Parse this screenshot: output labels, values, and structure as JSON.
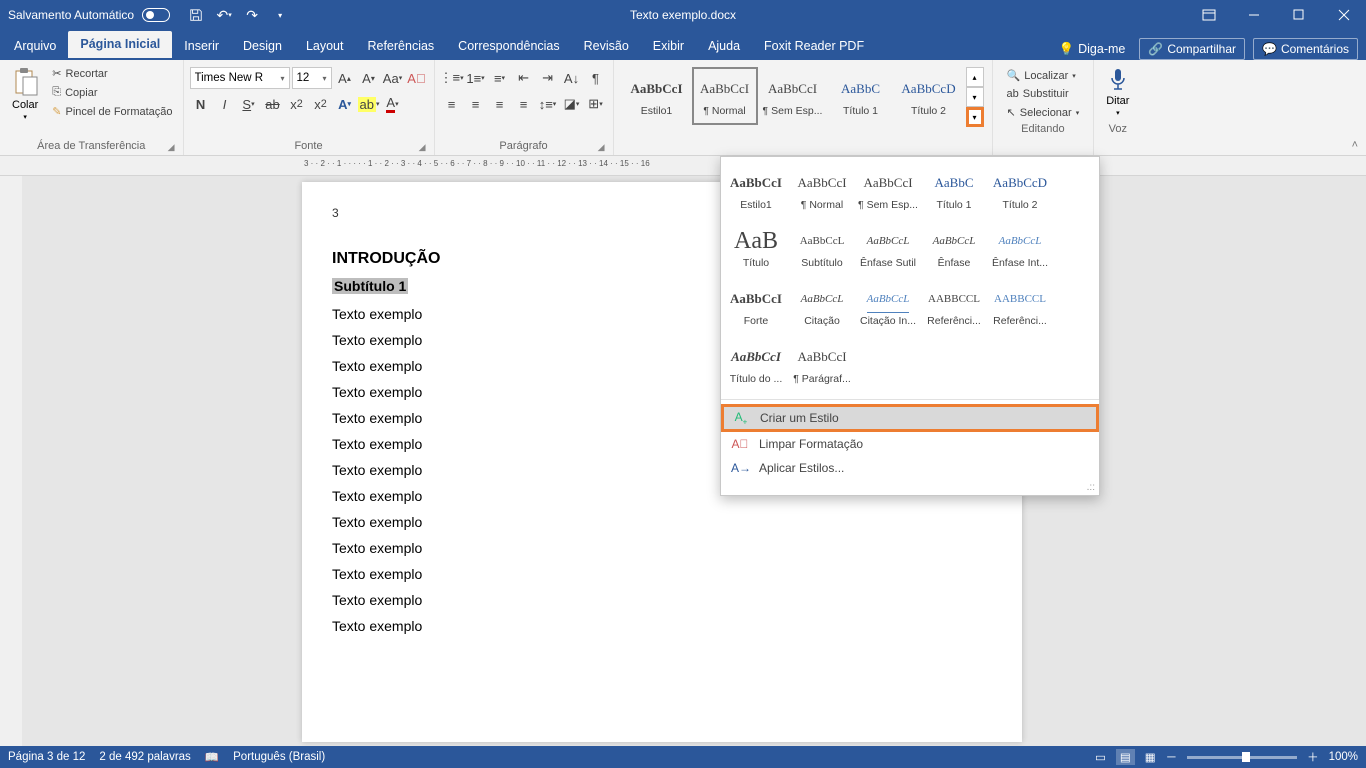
{
  "titlebar": {
    "autosave_label": "Salvamento Automático",
    "doc_title": "Texto exemplo.docx"
  },
  "tabs": {
    "arquivo": "Arquivo",
    "pagina_inicial": "Página Inicial",
    "inserir": "Inserir",
    "design": "Design",
    "layout": "Layout",
    "referencias": "Referências",
    "correspondencias": "Correspondências",
    "revisao": "Revisão",
    "exibir": "Exibir",
    "ajuda": "Ajuda",
    "foxit": "Foxit Reader PDF",
    "search_placeholder": "Diga-me",
    "share": "Compartilhar",
    "comments": "Comentários"
  },
  "ribbon": {
    "clipboard": {
      "paste": "Colar",
      "cut": "Recortar",
      "copy": "Copiar",
      "painter": "Pincel de Formatação",
      "group_label": "Área de Transferência"
    },
    "font": {
      "font_name": "Times New R",
      "font_size": "12",
      "group_label": "Fonte"
    },
    "paragraph": {
      "group_label": "Parágrafo"
    },
    "styles": {
      "row1": [
        {
          "preview": "AaBbCcI",
          "name": "Estilo1",
          "cls": "pv-bold"
        },
        {
          "preview": "AaBbCcI",
          "name": "¶ Normal",
          "box": true
        },
        {
          "preview": "AaBbCcI",
          "name": "¶ Sem Esp..."
        },
        {
          "preview": "AaBbC",
          "name": "Título 1",
          "cls": "pv-blue"
        },
        {
          "preview": "AaBbCcD",
          "name": "Título 2",
          "cls": "pv-blue"
        }
      ]
    },
    "editing": {
      "find": "Localizar",
      "replace": "Substituir",
      "select": "Selecionar",
      "group_label": "Editando"
    },
    "voice": {
      "dictate": "Ditar",
      "group_label": "Voz"
    }
  },
  "styles_dropdown": {
    "grid": [
      {
        "preview": "AaBbCcI",
        "name": "Estilo1",
        "cls": "pv-bold"
      },
      {
        "preview": "AaBbCcI",
        "name": "¶ Normal",
        "box": true
      },
      {
        "preview": "AaBbCcI",
        "name": "¶ Sem Esp..."
      },
      {
        "preview": "AaBbC",
        "name": "Título 1",
        "cls": "pv-blue"
      },
      {
        "preview": "AaBbCcD",
        "name": "Título 2",
        "cls": "pv-blue"
      },
      {
        "preview": "AaB",
        "name": "Título",
        "big": true
      },
      {
        "preview": "AaBbCcL",
        "name": "Subtítulo",
        "cls": "pv-small"
      },
      {
        "preview": "AaBbCcL",
        "name": "Ênfase Sutil",
        "cls": "pv-italic pv-small"
      },
      {
        "preview": "AaBbCcL",
        "name": "Ênfase",
        "cls": "pv-italic pv-small"
      },
      {
        "preview": "AaBbCcL",
        "name": "Ênfase Int...",
        "cls": "pv-italic pv-lightblue pv-small"
      },
      {
        "preview": "AaBbCcI",
        "name": "Forte",
        "cls": "pv-bold"
      },
      {
        "preview": "AaBbCcL",
        "name": "Citação",
        "cls": "pv-italic pv-small"
      },
      {
        "preview": "AaBbCcL",
        "name": "Citação In...",
        "cls": "pv-italic pv-lightblue pv-under pv-small"
      },
      {
        "preview": "AABBCCL",
        "name": "Referênci...",
        "cls": "pv-sc pv-small"
      },
      {
        "preview": "AABBCCL",
        "name": "Referênci...",
        "cls": "pv-sc pv-lightblue pv-small"
      },
      {
        "preview": "AaBbCcI",
        "name": "Título do ...",
        "cls": "pv-bold pv-italic"
      },
      {
        "preview": "AaBbCcI",
        "name": "¶ Parágraf..."
      }
    ],
    "create": "Criar um Estilo",
    "clear": "Limpar Formatação",
    "apply": "Aplicar Estilos..."
  },
  "document": {
    "page_num": "3",
    "heading": "INTRODUÇÃO",
    "subheading": "Subtítulo 1",
    "line": "Texto exemplo",
    "line_count": 13
  },
  "statusbar": {
    "page": "Página 3 de 12",
    "words": "2 de 492 palavras",
    "lang": "Português (Brasil)",
    "zoom": "100%"
  },
  "ruler_text": "3 · · 2 · · 1 · · · · · 1 · · 2 · · 3 · · 4 · · 5 · · 6 · · 7 · · 8 · · 9 · · 10 · · 11 · · 12 · · 13 · · 14 · · 15 · · 16"
}
